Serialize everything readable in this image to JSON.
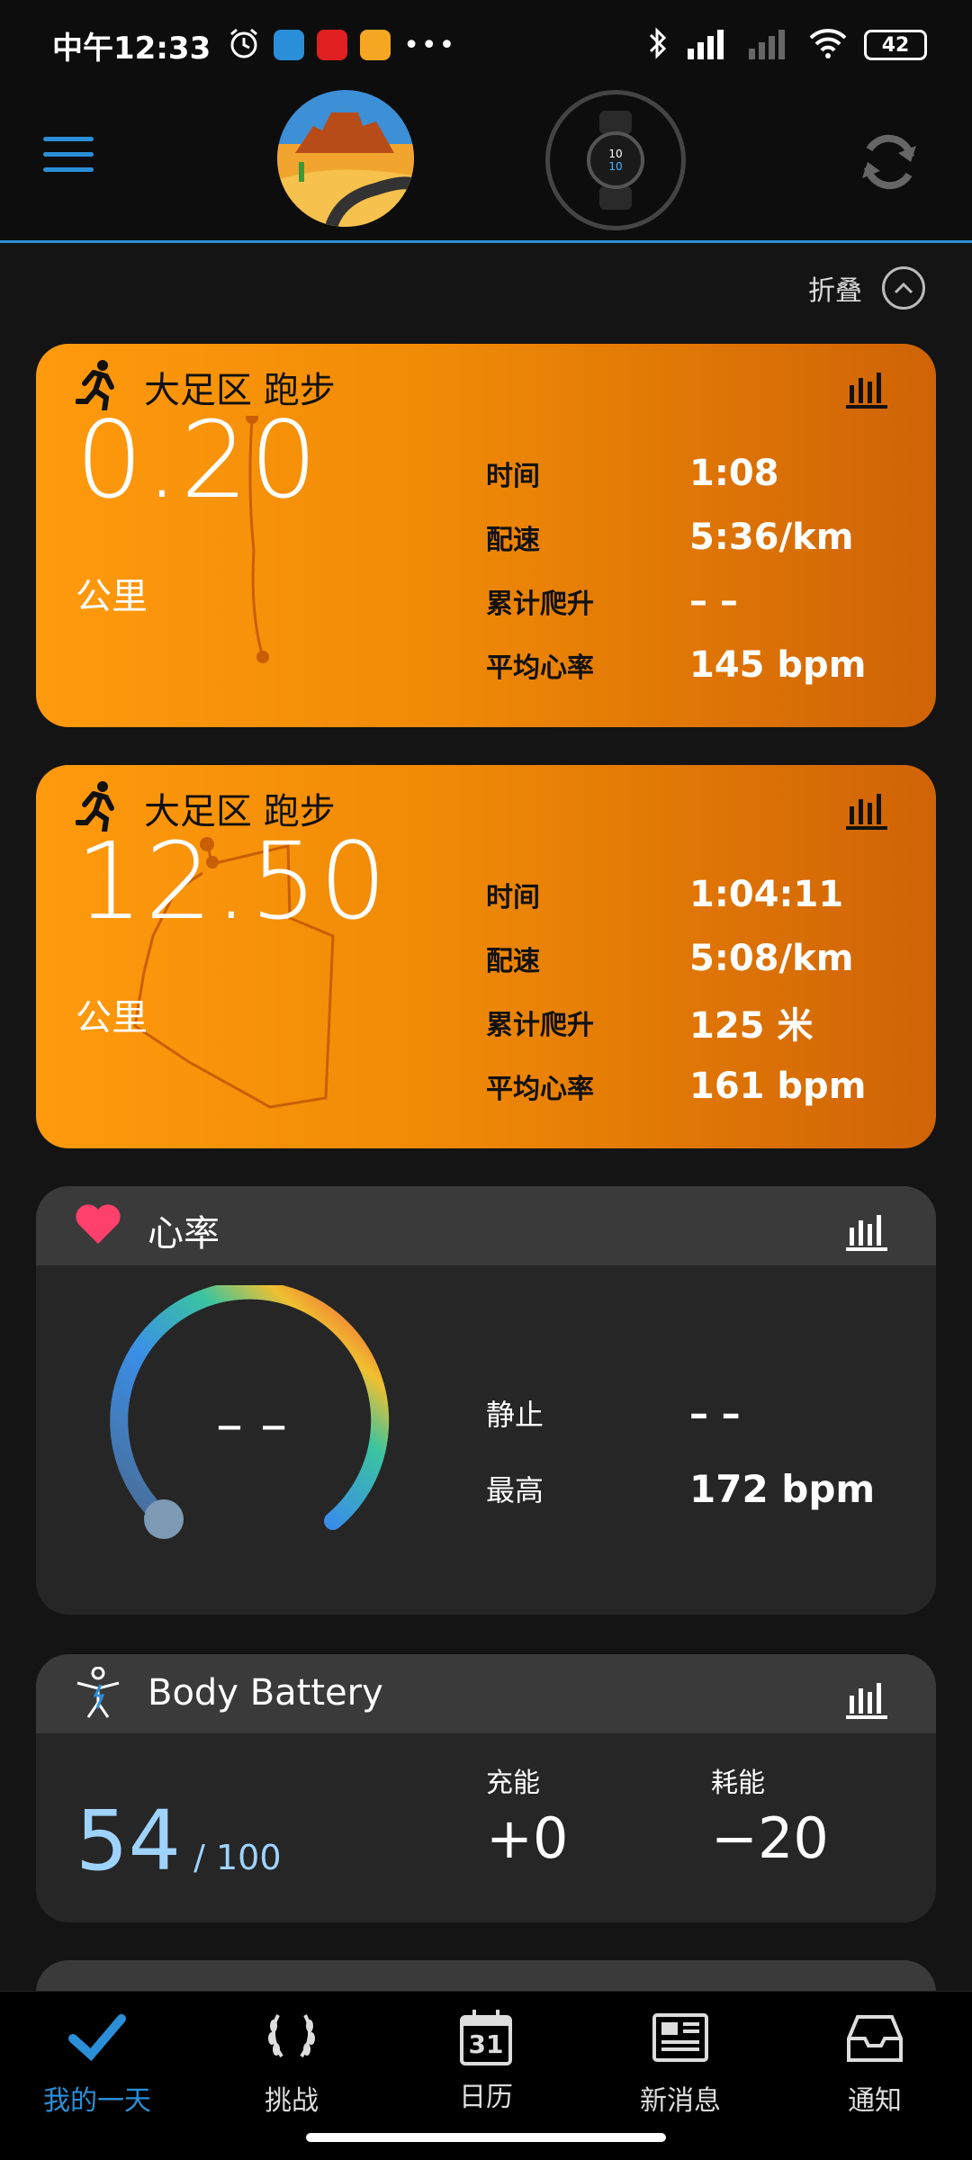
{
  "status": {
    "time": "中午12:33",
    "battery": "42"
  },
  "header": {
    "collapse_label": "折叠"
  },
  "cards": [
    {
      "title": "大足区 跑步",
      "distance": "0.20",
      "unit": "公里",
      "stats": [
        {
          "label": "时间",
          "value": "1:08"
        },
        {
          "label": "配速",
          "value": "5:36/km"
        },
        {
          "label": "累计爬升",
          "value": "– –"
        },
        {
          "label": "平均心率",
          "value": "145 bpm"
        }
      ]
    },
    {
      "title": "大足区 跑步",
      "distance": "12.50",
      "unit": "公里",
      "stats": [
        {
          "label": "时间",
          "value": "1:04:11"
        },
        {
          "label": "配速",
          "value": "5:08/km"
        },
        {
          "label": "累计爬升",
          "value": "125 米"
        },
        {
          "label": "平均心率",
          "value": "161 bpm"
        }
      ]
    }
  ],
  "heart_rate": {
    "title": "心率",
    "current": "– –",
    "rest_label": "静止",
    "rest_value": "– –",
    "max_label": "最高",
    "max_value": "172 bpm"
  },
  "body_battery": {
    "title": "Body Battery",
    "value": "54",
    "max": "/ 100",
    "charge_label": "充能",
    "charge_value": "+0",
    "drain_label": "耗能",
    "drain_value": "−20"
  },
  "nav": [
    {
      "label": "我的一天",
      "icon": "check-icon",
      "active": true
    },
    {
      "label": "挑战",
      "icon": "laurel-icon"
    },
    {
      "label": "日历",
      "icon": "calendar-icon",
      "date": "31"
    },
    {
      "label": "新消息",
      "icon": "newspaper-icon"
    },
    {
      "label": "通知",
      "icon": "inbox-icon"
    }
  ],
  "colors": {
    "accent": "#2a8fd8",
    "run_card": "#f08a06",
    "heart": "#ff3f6c"
  }
}
